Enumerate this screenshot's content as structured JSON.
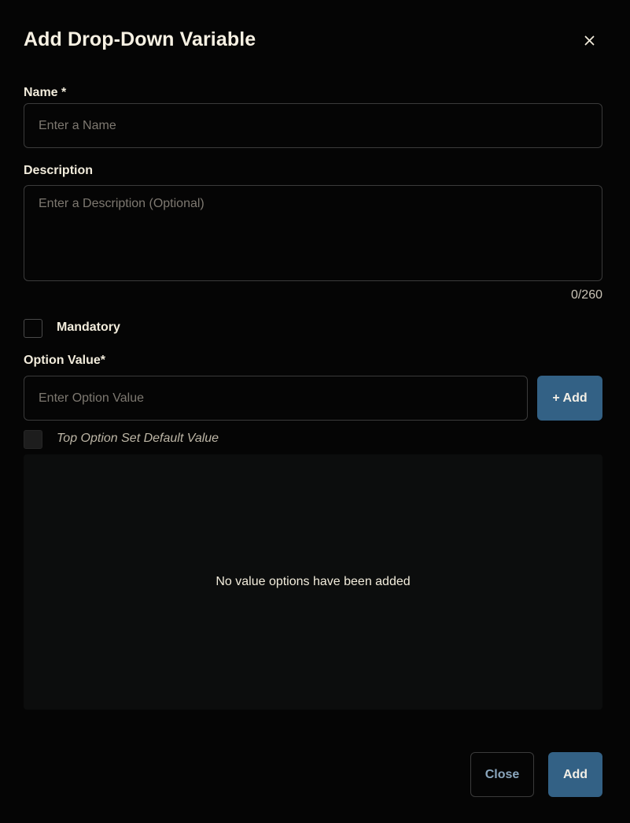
{
  "dialog": {
    "title": "Add Drop-Down Variable",
    "close_icon": "close-icon"
  },
  "name_field": {
    "label": "Name *",
    "placeholder": "Enter a Name",
    "value": ""
  },
  "description_field": {
    "label": "Description",
    "placeholder": "Enter a Description (Optional)",
    "value": "",
    "char_count": "0/260"
  },
  "mandatory": {
    "label": "Mandatory",
    "checked": false
  },
  "option_value": {
    "label": "Option Value*",
    "placeholder": "Enter Option Value",
    "value": "",
    "add_button_label": "+ Add"
  },
  "top_option_default": {
    "label": "Top Option Set Default Value",
    "checked": false
  },
  "options_list": {
    "empty_message": "No value options have been added",
    "items": []
  },
  "footer": {
    "close_label": "Close",
    "add_label": "Add"
  },
  "colors": {
    "background": "#050505",
    "primary": "#336185",
    "panel": "#0c0d0d",
    "border": "#3b3b3b"
  }
}
